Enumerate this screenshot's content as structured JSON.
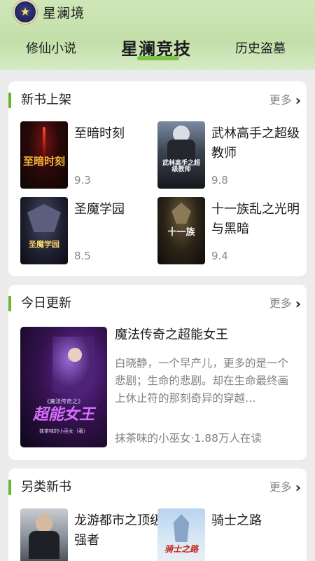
{
  "app": {
    "title": "星澜境",
    "logo_icon": "star-emblem-icon"
  },
  "tabs": [
    {
      "label": "修仙小说",
      "active": false
    },
    {
      "label": "星澜竞技",
      "active": true
    },
    {
      "label": "历史盗墓",
      "active": false
    }
  ],
  "new_books": {
    "title": "新书上架",
    "more": "更多",
    "books": [
      {
        "title": "至暗时刻",
        "score": "9.3",
        "cover_text": "至暗时刻"
      },
      {
        "title": "武林高手之超级教师",
        "score": "9.8",
        "cover_text": "武林高手之超级教师"
      },
      {
        "title": "圣魔学园",
        "score": "8.5",
        "cover_text": "圣魔学园"
      },
      {
        "title": "十一族乱之光明与黑暗",
        "score": "9.4",
        "cover_text": "十一族"
      }
    ]
  },
  "today_update": {
    "title": "今日更新",
    "more": "更多",
    "book": {
      "title": "魔法传奇之超能女王",
      "description": "白晓静，一个早产儿，更多的是一个悲剧；生命的悲剧。却在生命最终画上休止符的那刻奇异的穿越…",
      "meta": "抹茶味的小巫女·1.88万人在读",
      "cover_small": "《魔法传奇之》",
      "cover_big": "超能女王",
      "cover_author": "抹茶味的小巫女（著）"
    }
  },
  "other_new": {
    "title": "另类新书",
    "more": "更多",
    "books": [
      {
        "title": "龙游都市之顶级强者"
      },
      {
        "title": "骑士之路",
        "cover_text": "骑士之路"
      }
    ]
  },
  "colors": {
    "accent": "#69b534",
    "header": "#c3dfa9",
    "background": "#ececec"
  }
}
